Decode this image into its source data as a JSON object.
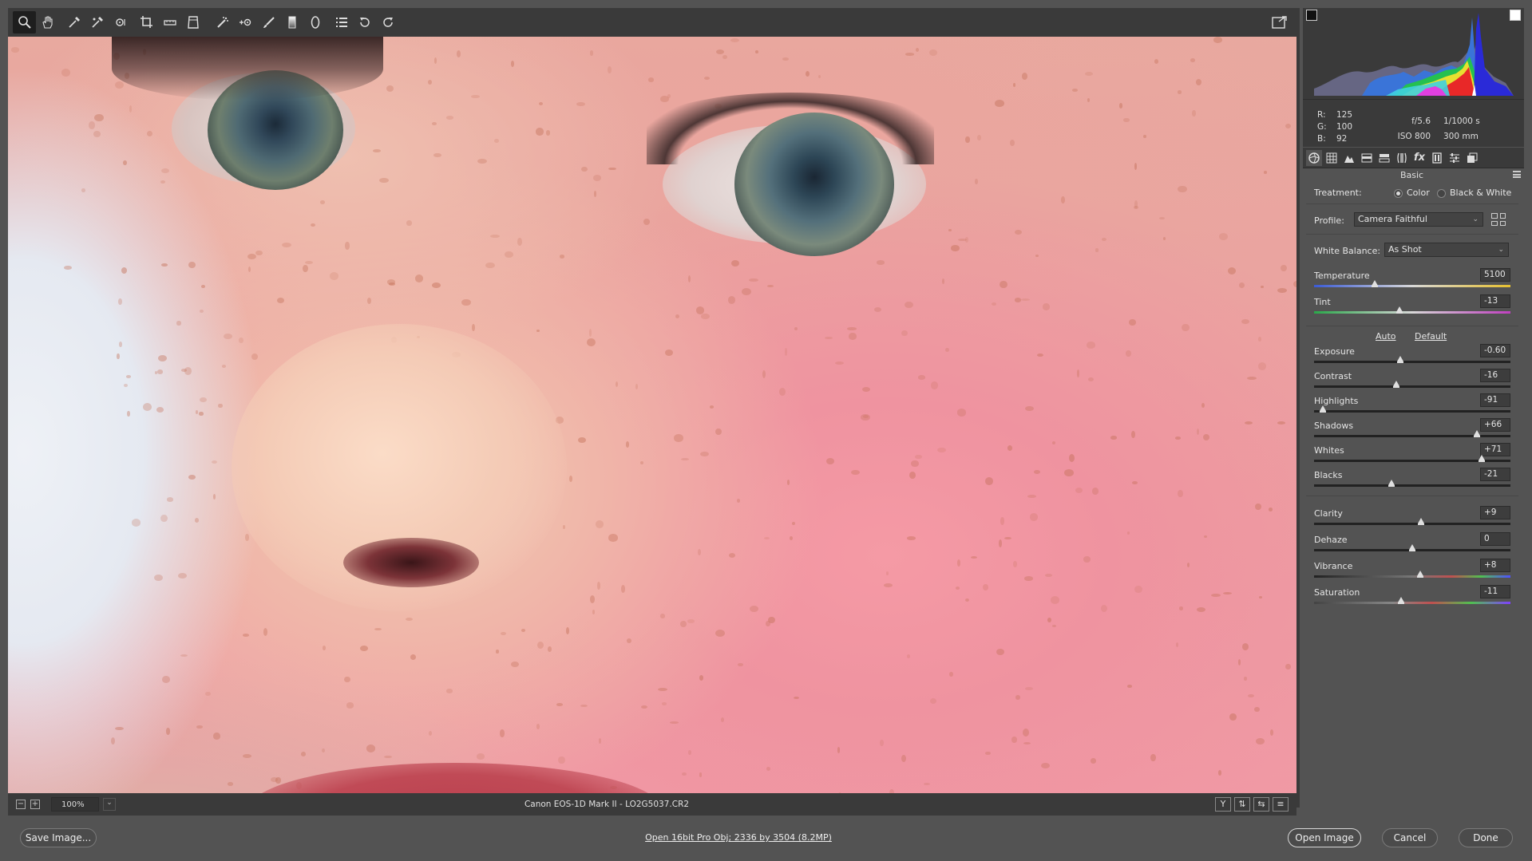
{
  "toolbar": {
    "tools": [
      {
        "name": "zoom-tool",
        "icon": "magnifier-icon"
      },
      {
        "name": "hand-tool",
        "icon": "hand-icon"
      },
      {
        "name": "white-balance-tool",
        "icon": "eyedropper-icon"
      },
      {
        "name": "color-sampler-tool",
        "icon": "color-sampler-icon"
      },
      {
        "name": "targeted-adjustment-tool",
        "icon": "target-adjust-icon"
      },
      {
        "name": "crop-tool",
        "icon": "crop-icon"
      },
      {
        "name": "straighten-tool",
        "icon": "straighten-icon"
      },
      {
        "name": "transform-tool",
        "icon": "transform-icon"
      },
      {
        "name": "spot-removal-tool",
        "icon": "spot-removal-icon"
      },
      {
        "name": "red-eye-tool",
        "icon": "red-eye-icon"
      },
      {
        "name": "adjustment-brush-tool",
        "icon": "brush-icon"
      },
      {
        "name": "graduated-filter-tool",
        "icon": "graduated-filter-icon"
      },
      {
        "name": "radial-filter-tool",
        "icon": "radial-filter-icon"
      },
      {
        "name": "preferences-tool",
        "icon": "list-icon"
      },
      {
        "name": "rotate-left-tool",
        "icon": "rotate-ccw-icon"
      },
      {
        "name": "rotate-right-tool",
        "icon": "rotate-cw-icon"
      }
    ]
  },
  "image_bar": {
    "zoom": "100%",
    "filename": "Canon EOS-1D Mark II  -  LO2G5037.CR2",
    "view_buttons": [
      "Y",
      "⇅",
      "⇆",
      "≡"
    ]
  },
  "histogram": {
    "r_label": "R:",
    "r": "125",
    "g_label": "G:",
    "g": "100",
    "b_label": "B:",
    "b": "92",
    "aperture": "f/5.6",
    "shutter": "1/1000 s",
    "iso": "ISO 800",
    "focal": "300 mm"
  },
  "panel": {
    "section_title": "Basic",
    "treatment_label": "Treatment:",
    "treatment_color": "Color",
    "treatment_bw": "Black & White",
    "profile_label": "Profile:",
    "profile_value": "Camera Faithful",
    "wb_label": "White Balance:",
    "wb_value": "As Shot",
    "auto": "Auto",
    "default": "Default",
    "sliders": [
      {
        "label": "Temperature",
        "value": "5100",
        "pos": 0.31
      },
      {
        "label": "Tint",
        "value": "-13",
        "pos": 0.435
      },
      {
        "label": "Exposure",
        "value": "-0.60",
        "pos": 0.44
      },
      {
        "label": "Contrast",
        "value": "-16",
        "pos": 0.42
      },
      {
        "label": "Highlights",
        "value": "-91",
        "pos": 0.045
      },
      {
        "label": "Shadows",
        "value": "+66",
        "pos": 0.83
      },
      {
        "label": "Whites",
        "value": "+71",
        "pos": 0.855
      },
      {
        "label": "Blacks",
        "value": "-21",
        "pos": 0.395
      },
      {
        "label": "Clarity",
        "value": "+9",
        "pos": 0.545
      },
      {
        "label": "Dehaze",
        "value": "0",
        "pos": 0.5
      },
      {
        "label": "Vibrance",
        "value": "+8",
        "pos": 0.54
      },
      {
        "label": "Saturation",
        "value": "-11",
        "pos": 0.445
      }
    ]
  },
  "bottom": {
    "save": "Save Image...",
    "workflow": "Open 16bit Pro Obj; 2336 by 3504 (8.2MP)",
    "open": "Open Image",
    "cancel": "Cancel",
    "done": "Done"
  }
}
